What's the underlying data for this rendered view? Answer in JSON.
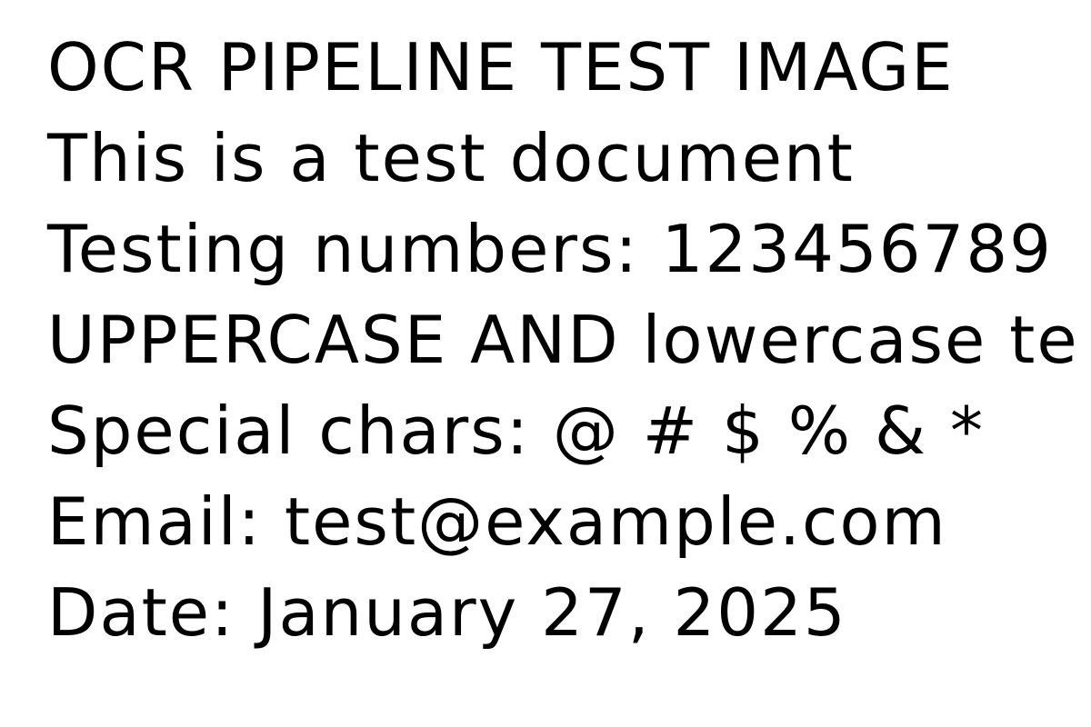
{
  "document": {
    "lines": [
      "OCR PIPELINE TEST IMAGE",
      "This is a test document",
      "Testing numbers: 123456789",
      "UPPERCASE AND lowercase te",
      "Special chars: @ # $ % & *",
      "Email: test@example.com",
      "Date: January 27, 2025"
    ]
  },
  "colors": {
    "background": "#ffffff",
    "text": "#000000"
  }
}
